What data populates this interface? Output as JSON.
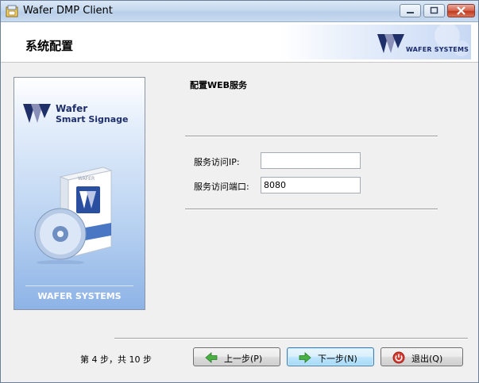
{
  "window": {
    "title": "Wafer DMP Client"
  },
  "header": {
    "title": "系统配置",
    "logo_text": "WAFER SYSTEMS"
  },
  "banner": {
    "name_line1": "Wafer",
    "name_line2": "Smart Signage",
    "footer": "WAFER SYSTEMS",
    "box_label": "WAFER"
  },
  "section": {
    "title": "配置WEB服务"
  },
  "fields": {
    "ip": {
      "label": "服务访问IP:",
      "value": ""
    },
    "port": {
      "label": "服务访问端口:",
      "value": "8080"
    }
  },
  "footer": {
    "step_info": "第 4 步，共 10 步",
    "prev_label": "上一步(P)",
    "next_label": "下一步(N)",
    "exit_label": "退出(Q)"
  },
  "colors": {
    "logo_blue": "#1f2f6a",
    "prev_arrow": "#3aa53a",
    "next_arrow": "#3aa53a",
    "exit_icon": "#d0342c"
  }
}
